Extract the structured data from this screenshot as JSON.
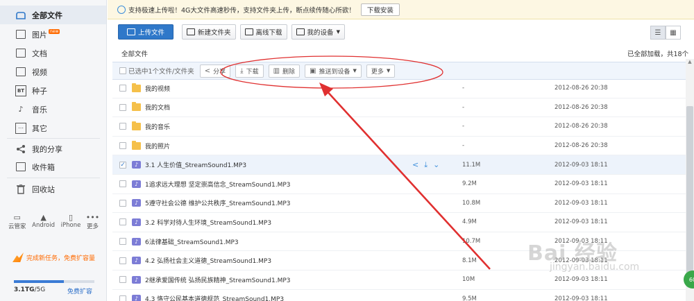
{
  "sidebar": {
    "items": [
      {
        "label": "全部文件",
        "icon": "cloud-icon"
      },
      {
        "label": "图片",
        "icon": "image-icon",
        "badge": "new"
      },
      {
        "label": "文档",
        "icon": "document-icon"
      },
      {
        "label": "视频",
        "icon": "video-icon"
      },
      {
        "label": "种子",
        "icon": "bt-icon",
        "icon_text": "BT"
      },
      {
        "label": "音乐",
        "icon": "music-icon"
      },
      {
        "label": "其它",
        "icon": "more-icon"
      },
      {
        "label": "我的分享",
        "icon": "share-icon"
      },
      {
        "label": "收件箱",
        "icon": "inbox-icon"
      },
      {
        "label": "回收站",
        "icon": "trash-icon"
      }
    ],
    "devices": [
      {
        "label": "云管家",
        "icon": "monitor-icon"
      },
      {
        "label": "Android",
        "icon": "android-icon"
      },
      {
        "label": "iPhone",
        "icon": "iphone-icon"
      },
      {
        "label": "更多",
        "icon": "ellipsis-icon"
      }
    ],
    "promo": "完成新任务，免费扩容量",
    "storage": {
      "used": "3.1TG",
      "total": "/5G",
      "fraction": 0.62,
      "expand_label": "免费扩容"
    }
  },
  "notice": {
    "text": "支持极速上传啦！4G大文件高速秒传，支持文件夹上传，断点续传随心所欲！",
    "button": "下载安装"
  },
  "toolbar": {
    "upload": "上传文件",
    "new_folder": "新建文件夹",
    "offline": "离线下载",
    "my_device": "我的设备"
  },
  "breadcrumb": "全部文件",
  "loaded_text": "已全部加载，共18个",
  "action_bar": {
    "selected_text": "已选中1个文件/文件夹",
    "share": "分享",
    "download": "下载",
    "delete": "删除",
    "push": "推送到设备",
    "more": "更多"
  },
  "files": [
    {
      "name": "我的视频",
      "type": "folder",
      "size": "-",
      "date": "2012-08-26 20:38",
      "selected": false
    },
    {
      "name": "我的文档",
      "type": "folder",
      "size": "-",
      "date": "2012-08-26 20:38",
      "selected": false
    },
    {
      "name": "我的音乐",
      "type": "folder",
      "size": "-",
      "date": "2012-08-26 20:38",
      "selected": false
    },
    {
      "name": "我的照片",
      "type": "folder",
      "size": "-",
      "date": "2012-08-26 20:38",
      "selected": false
    },
    {
      "name": "3.1 人生价值_StreamSound1.MP3",
      "type": "audio",
      "size": "11.1M",
      "date": "2012-09-03 18:11",
      "selected": true
    },
    {
      "name": "1追求远大理想 坚定崇高信念_StreamSound1.MP3",
      "type": "audio",
      "size": "9.2M",
      "date": "2012-09-03 18:11",
      "selected": false
    },
    {
      "name": "5遵守社会公德 维护公共秩序_StreamSound1.MP3",
      "type": "audio",
      "size": "10.8M",
      "date": "2012-09-03 18:11",
      "selected": false
    },
    {
      "name": "3.2 科学对待人生环境_StreamSound1.MP3",
      "type": "audio",
      "size": "4.9M",
      "date": "2012-09-03 18:11",
      "selected": false
    },
    {
      "name": "6法律基础_StreamSound1.MP3",
      "type": "audio",
      "size": "10.7M",
      "date": "2012-09-03 18:11",
      "selected": false
    },
    {
      "name": "4.2 弘扬社会主义道德_StreamSound1.MP3",
      "type": "audio",
      "size": "8.1M",
      "date": "2012-09-03 18:11",
      "selected": false
    },
    {
      "name": "2继承爱国传统 弘扬民族精神_StreamSound1.MP3",
      "type": "audio",
      "size": "10M",
      "date": "2012-09-03 18:11",
      "selected": false
    },
    {
      "name": "4.3 恪守公民基本道德规范_StreamSound1.MP3",
      "type": "audio",
      "size": "9.5M",
      "date": "2012-09-03 18:11",
      "selected": false
    }
  ],
  "watermark": {
    "main": "Bai 经验",
    "sub": "jingyan.baidu.com"
  },
  "corner_badge": "60",
  "colors": {
    "accent": "#2f78c9",
    "annotation": "#e03030",
    "folder": "#f5c04a",
    "audio": "#7c7cd6"
  }
}
